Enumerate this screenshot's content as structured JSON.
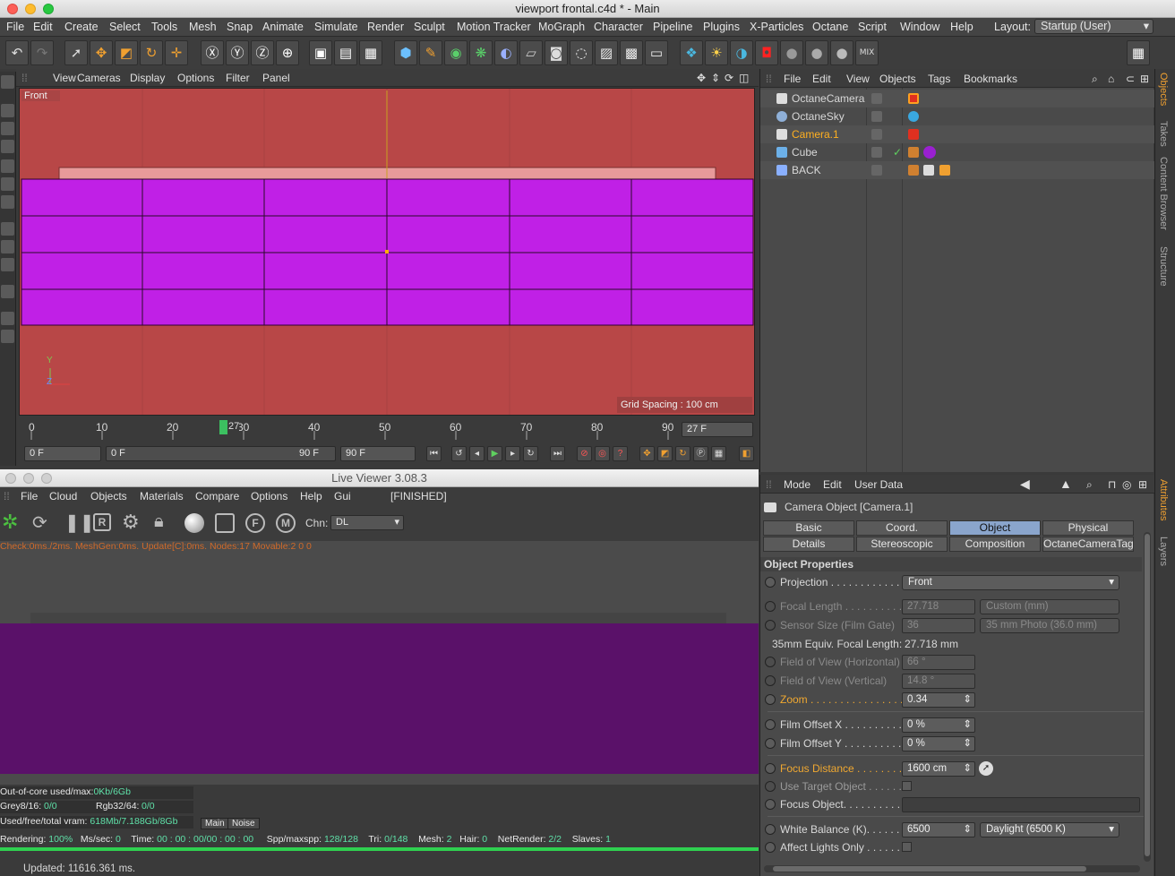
{
  "window": {
    "title": "viewport frontal.c4d * - Main"
  },
  "menu": [
    "File",
    "Edit",
    "Create",
    "Select",
    "Tools",
    "Mesh",
    "Snap",
    "Animate",
    "Simulate",
    "Render",
    "Sculpt",
    "Motion Tracker",
    "MoGraph",
    "Character",
    "Pipeline",
    "Plugins",
    "X-Particles",
    "Octane",
    "Script",
    "Window",
    "Help"
  ],
  "layout": {
    "label": "Layout:",
    "value": "Startup (User)"
  },
  "viewport": {
    "menu": [
      "View",
      "Cameras",
      "Display",
      "Options",
      "Filter",
      "Panel"
    ],
    "name": "Front",
    "grid_spacing": "Grid Spacing : 100 cm",
    "axis_y": "Y",
    "axis_z": "Z",
    "colors": {
      "background": "#b84747",
      "cube": "#c020e6",
      "top_strip": "#e89a9a"
    }
  },
  "timeline": {
    "ticks": [
      "0",
      "10",
      "20",
      "30",
      "40",
      "50",
      "60",
      "70",
      "80",
      "90"
    ],
    "current_marker": "27",
    "current_frame_field": "27 F"
  },
  "playback": {
    "start": "0 F",
    "range_start": "0 F",
    "range_end": "90 F",
    "end": "90 F"
  },
  "objects_panel": {
    "menu": [
      "File",
      "Edit",
      "View",
      "Objects",
      "Tags",
      "Bookmarks"
    ],
    "items": [
      {
        "name": "OctaneCamera",
        "selected": false
      },
      {
        "name": "OctaneSky",
        "selected": false
      },
      {
        "name": "Camera.1",
        "selected": true
      },
      {
        "name": "Cube",
        "selected": false
      },
      {
        "name": "BACK",
        "selected": false
      }
    ]
  },
  "side_tabs": {
    "top": [
      "Objects",
      "Takes",
      "Content Browser",
      "Structure"
    ],
    "bottom": [
      "Attributes",
      "Layers"
    ]
  },
  "live_viewer": {
    "title": "Live Viewer 3.08.3",
    "menu": [
      "File",
      "Cloud",
      "Objects",
      "Materials",
      "Compare",
      "Options",
      "Help",
      "Gui"
    ],
    "status": "[FINISHED]",
    "channel_label": "Chn:",
    "channel_value": "DL",
    "check_line": "Check:0ms./2ms. MeshGen:0ms. Update[C]:0ms. Nodes:17 Movable:2  0 0",
    "render_color": "#5a1169",
    "stats": {
      "ooc_label": "Out-of-core used/max:",
      "ooc_value": "0Kb/6Gb",
      "grey_label": "Grey8/16:",
      "grey_value": "0/0",
      "rgb_label": "Rgb32/64:",
      "rgb_value": "0/0",
      "vram_label": "Used/free/total vram:",
      "vram_value": "618Mb/7.188Gb/8Gb",
      "tab_main": "Main",
      "tab_noise": "Noise",
      "rendering_label": "Rendering:",
      "rendering_value": "100%",
      "ms_label": "Ms/sec:",
      "ms_value": "0",
      "time_label": "Time:",
      "time_value": "00 : 00 : 00/00 : 00 : 00",
      "spp_label": "Spp/maxspp:",
      "spp_value": "128/128",
      "tri_label": "Tri:",
      "tri_value": "0/148",
      "mesh_label": "Mesh:",
      "mesh_value": "2",
      "hair_label": "Hair:",
      "hair_value": "0",
      "net_label": "NetRender:",
      "net_value": "2/2",
      "slaves_label": "Slaves:",
      "slaves_value": "1",
      "progress": 1.0
    },
    "updated": "Updated: 11616.361 ms."
  },
  "attributes": {
    "menu": [
      "Mode",
      "Edit",
      "User Data"
    ],
    "object_title": "Camera Object [Camera.1]",
    "tabs_row1": [
      "Basic",
      "Coord.",
      "Object",
      "Physical"
    ],
    "tabs_row2": [
      "Details",
      "Stereoscopic",
      "Composition",
      "OctaneCameraTag"
    ],
    "active_tab": "Object",
    "section": "Object Properties",
    "projection": {
      "label": "Projection . . . . . . . . . . . . . .",
      "value": "Front"
    },
    "focal_length": {
      "label": "Focal Length . . . . . . . . . . .",
      "value": "27.718",
      "preset": "Custom (mm)"
    },
    "sensor_size": {
      "label": "Sensor Size (Film Gate)",
      "value": "36",
      "preset": "35 mm Photo (36.0 mm)"
    },
    "equiv_label": "35mm Equiv. Focal Length:",
    "equiv_value": "27.718 mm",
    "fov_h": {
      "label": "Field of View (Horizontal)",
      "value": "66 °"
    },
    "fov_v": {
      "label": "Field of View (Vertical)",
      "value": "14.8 °"
    },
    "zoom": {
      "label": "Zoom . . . . . . . . . . . . . . . . . . .",
      "value": "0.34"
    },
    "film_x": {
      "label": "Film Offset X . . . . . . . . . . .",
      "value": "0 %"
    },
    "film_y": {
      "label": "Film Offset Y . . . . . . . . . . .",
      "value": "0 %"
    },
    "focus_distance": {
      "label": "Focus Distance . . . . . . . . .",
      "value": "1600 cm"
    },
    "use_target": {
      "label": "Use Target Object . . . . . ."
    },
    "focus_object": {
      "label": "Focus Object. . . . . . . . . . ."
    },
    "white_balance": {
      "label": "White Balance (K). . . . . . .",
      "value": "6500",
      "preset": "Daylight (6500 K)"
    },
    "affect_lights": {
      "label": "Affect Lights Only . . . . . ."
    }
  }
}
